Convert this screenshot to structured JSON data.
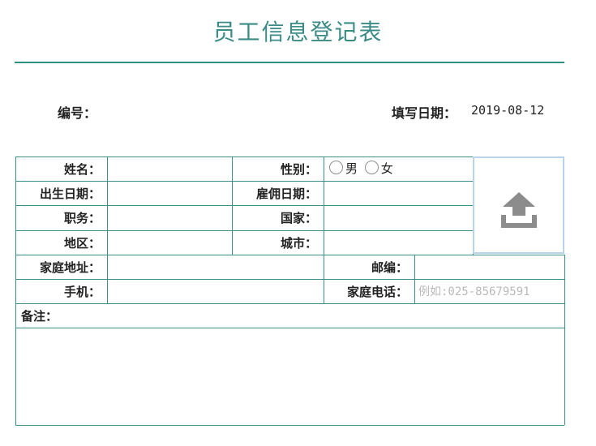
{
  "page": {
    "title": "员工信息登记表"
  },
  "meta": {
    "number_label": "编号：",
    "number_value": "",
    "fill_date_label": "填写日期：",
    "fill_date_value": "2019-08-12"
  },
  "form": {
    "name_label": "姓名：",
    "gender_label": "性别：",
    "gender_options": [
      "男",
      "女"
    ],
    "birthdate_label": "出生日期：",
    "hire_date_label": "雇佣日期：",
    "position_label": "职务：",
    "country_label": "国家：",
    "region_label": "地区：",
    "city_label": "城市：",
    "home_address_label": "家庭地址：",
    "postcode_label": "邮编：",
    "mobile_label": "手机：",
    "home_phone_label": "家庭电话：",
    "home_phone_placeholder": "例如:025-85679591",
    "remarks_label": "备注："
  },
  "photo": {
    "icon": "upload-icon",
    "icon_color": "#8c8c8c"
  },
  "colors": {
    "title": "#3b8b86",
    "border": "#3a8f8a",
    "photo_border": "#b9d3e8"
  }
}
